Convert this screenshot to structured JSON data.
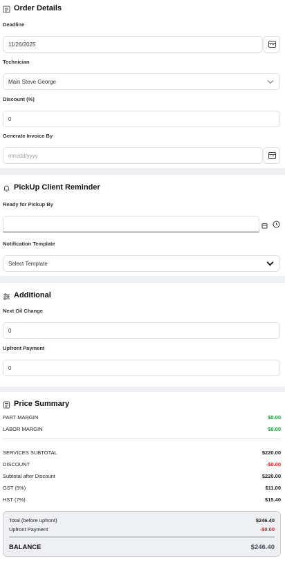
{
  "order_details": {
    "title": "Order Details",
    "icon": "document-icon",
    "deadline": {
      "label": "Deadline",
      "value": "11/26/2025"
    },
    "technician": {
      "label": "Technician",
      "value": "Main Steve  George"
    },
    "discount": {
      "label": "Discount (%)",
      "value": "0"
    },
    "invoice": {
      "label": "Generate Invoice By",
      "placeholder": "mm/dd/yyyy"
    }
  },
  "pickup": {
    "title": "PickUp Client Reminder",
    "icon": "bell-icon",
    "ready": {
      "label": "Ready for Pickup By",
      "value": ""
    },
    "template": {
      "label": "Notification Template",
      "value": "Select Template"
    }
  },
  "additional": {
    "title": "Additional",
    "icon": "sliders-icon",
    "oil": {
      "label": "Next Oil Change",
      "value": "0"
    },
    "upfront": {
      "label": "Upfront Payment",
      "value": "0"
    }
  },
  "price_summary": {
    "title": "Price Summary",
    "icon": "calculator-icon",
    "part_margin": {
      "label": "PART MARGIN",
      "value": "$0.00"
    },
    "labor_margin": {
      "label": "LABOR MARGIN",
      "value": "$0.00"
    },
    "services_subtotal": {
      "label": "SERVICES SUBTOTAL",
      "value": "$220.00"
    },
    "discount": {
      "label": "DISCOUNT",
      "value": "-$0.00"
    },
    "after_discount": {
      "label": "Subtotal after Discount",
      "value": "$220.00"
    },
    "gst": {
      "label": "GST (5%)",
      "value": "$11.00"
    },
    "hst": {
      "label": "HST (7%)",
      "value": "$15.40"
    },
    "total_before": {
      "label": "Total (before upfront)",
      "value": "$246.40"
    },
    "upfront": {
      "label": "Upfront Payment",
      "value": "-$0.00"
    },
    "balance": {
      "label": "BALANCE",
      "value": "$246.40"
    }
  },
  "colors": {
    "positive": "#1e9b3a",
    "negative": "#d32020",
    "page_bg": "#eef0f3"
  }
}
